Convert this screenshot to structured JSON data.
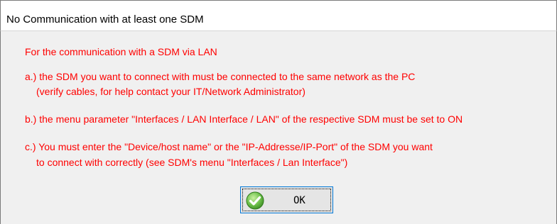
{
  "window": {
    "title": "No Communication with at least one SDM"
  },
  "message": {
    "intro": "For the communication with a SDM via LAN",
    "item_a_line1": "a.) the SDM you want to connect with must be connected to the same network as the PC",
    "item_a_line2": "(verify cables, for help contact your IT/Network Administrator)",
    "item_b": "b.) the menu parameter \"Interfaces / LAN Interface / LAN\" of the respective SDM must be set to ON",
    "item_c_line1": "c.) You must enter the \"Device/host name\" or the \"IP-Addresse/IP-Port\" of the SDM you want",
    "item_c_line2": "to connect with correctly (see SDM's menu \"Interfaces / Lan Interface\")",
    "text_color": "#ff0000"
  },
  "buttons": {
    "ok_label": "OK",
    "ok_icon": "checkmark-icon"
  }
}
